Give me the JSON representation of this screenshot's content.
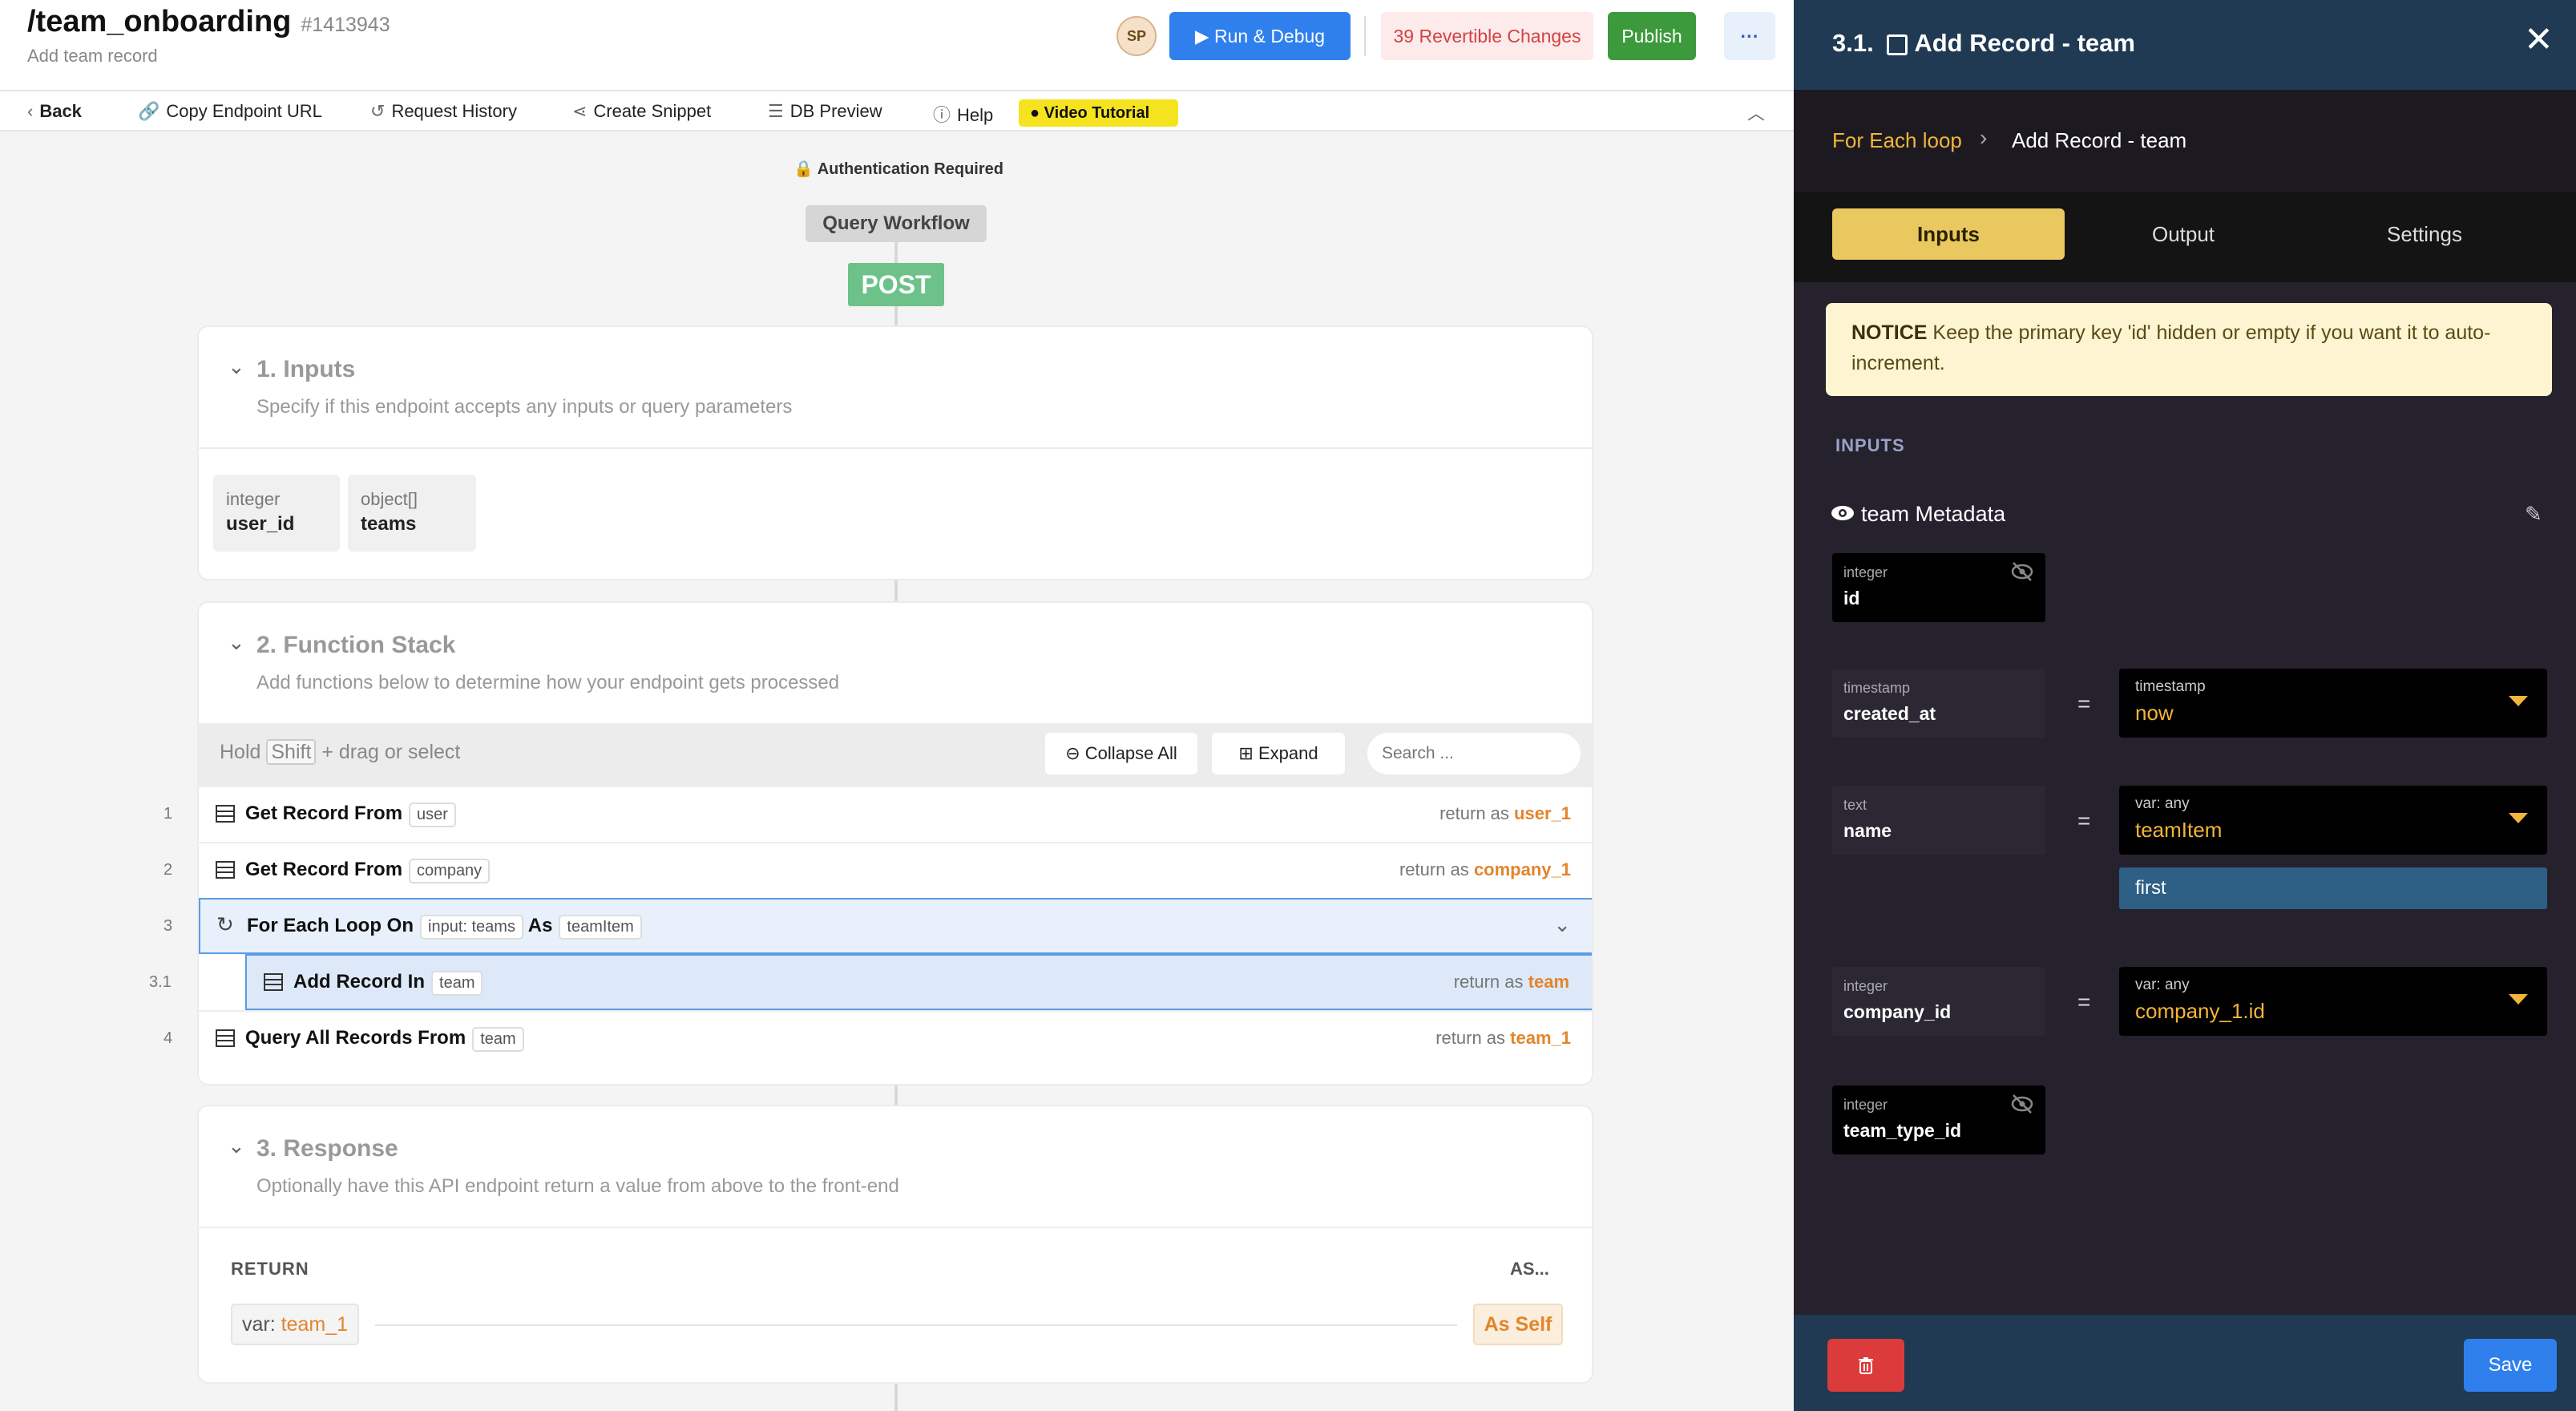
{
  "header": {
    "path": "/team_onboarding",
    "id": "#1413943",
    "subtitle": "Add team record",
    "avatar": "SP",
    "run_label": "Run & Debug",
    "changes_label": "39 Revertible Changes",
    "publish_label": "Publish",
    "more_label": "···"
  },
  "toolbar": {
    "back": "Back",
    "copy_url": "Copy Endpoint URL",
    "history": "Request History",
    "snippet": "Create Snippet",
    "db_preview": "DB Preview",
    "help": "Help",
    "video": "Video Tutorial"
  },
  "flow": {
    "auth": "Authentication Required",
    "query_workflow": "Query Workflow",
    "method": "POST"
  },
  "inputs": {
    "title": "1. Inputs",
    "desc": "Specify if this endpoint accepts any inputs or query parameters",
    "items": [
      {
        "type": "integer",
        "name": "user_id"
      },
      {
        "type": "object[]",
        "name": "teams"
      }
    ]
  },
  "function_stack": {
    "title": "2. Function Stack",
    "desc": "Add functions below to determine how your endpoint gets processed",
    "hint_hold": "Hold",
    "hint_key": "Shift",
    "hint_rest": "+ drag or select",
    "collapse": "Collapse All",
    "expand": "Expand",
    "search_placeholder": "Search ...",
    "rows": [
      {
        "num": "1",
        "label": "Get Record From",
        "tag": "user",
        "ret_label": "return as",
        "ret": "user_1"
      },
      {
        "num": "2",
        "label": "Get Record From",
        "tag": "company",
        "ret_label": "return as",
        "ret": "company_1"
      },
      {
        "num": "3",
        "label": "For Each Loop On",
        "tag": "input: teams",
        "as": "As",
        "tag2": "teamItem"
      },
      {
        "num": "3.1",
        "label": "Add Record In",
        "tag": "team",
        "ret_label": "return as",
        "ret": "team"
      },
      {
        "num": "4",
        "label": "Query All Records From",
        "tag": "team",
        "ret_label": "return as",
        "ret": "team_1"
      }
    ]
  },
  "response": {
    "title": "3. Response",
    "desc": "Optionally have this API endpoint return a value from above to the front-end",
    "return_label": "RETURN",
    "as_label": "AS...",
    "var_prefix": "var:",
    "var": "team_1",
    "as_value": "As Self"
  },
  "panel": {
    "title": "3.1.",
    "title_rest": "Add Record - team",
    "crumb_parent": "For Each loop",
    "crumb_current": "Add Record - team",
    "tabs": [
      "Inputs",
      "Output",
      "Settings"
    ],
    "notice_bold": "NOTICE",
    "notice_text": "Keep the primary key 'id' hidden or empty if you want it to auto-increment.",
    "inputs_label": "INPUTS",
    "metadata": "team Metadata",
    "fields": [
      {
        "type": "integer",
        "name": "id"
      },
      {
        "type": "timestamp",
        "name": "created_at",
        "val_type": "timestamp",
        "val": "now"
      },
      {
        "type": "text",
        "name": "name",
        "val_type": "var: any",
        "val": "teamItem",
        "filter": "first"
      },
      {
        "type": "integer",
        "name": "company_id",
        "val_type": "var: any",
        "val": "company_1.id"
      },
      {
        "type": "integer",
        "name": "team_type_id"
      }
    ],
    "eq": "=",
    "save": "Save"
  },
  "colors": {
    "accent": "#2f80ed",
    "orange": "#e2852c",
    "gold": "#f3b43b",
    "panel_bg": "#25212d"
  }
}
